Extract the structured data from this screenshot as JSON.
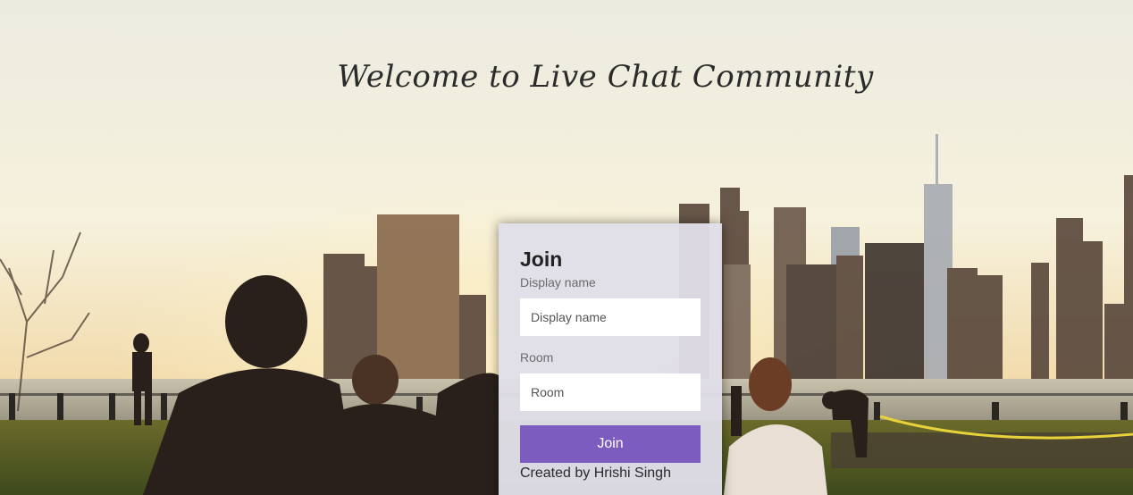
{
  "page": {
    "headline": "Welcome to Live Chat Community"
  },
  "join_form": {
    "title": "Join",
    "display_name": {
      "label": "Display name",
      "placeholder": "Display name",
      "value": ""
    },
    "room": {
      "label": "Room",
      "placeholder": "Room",
      "value": ""
    },
    "submit_label": "Join",
    "credit": "Created by Hrishi Singh"
  },
  "colors": {
    "button": "#7c5cbf",
    "panel": "#e0dee8",
    "headline": "#2b2b2b"
  }
}
